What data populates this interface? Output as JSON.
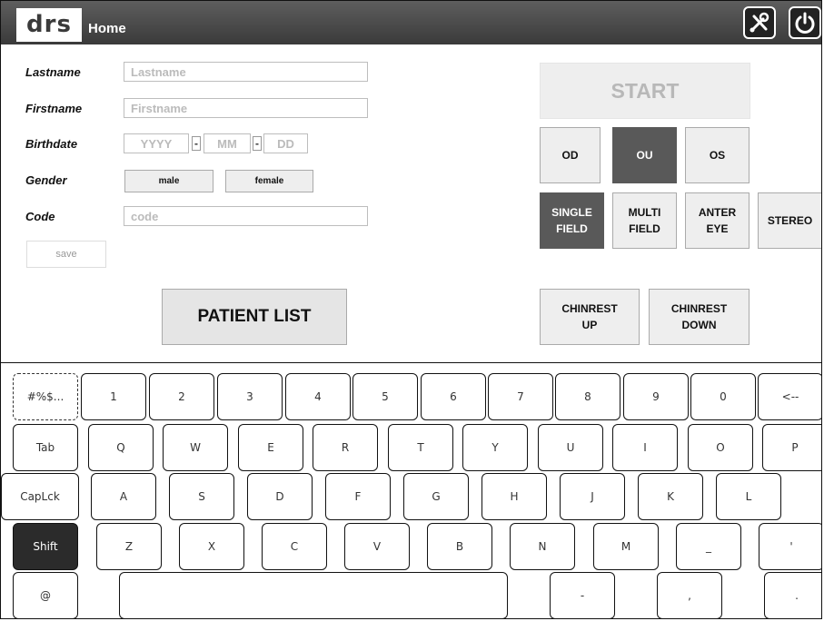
{
  "header": {
    "logo": "drs",
    "title": "Home",
    "icons": [
      "tools-icon",
      "power-icon"
    ]
  },
  "form": {
    "lastname": {
      "label": "Lastname",
      "placeholder": "Lastname"
    },
    "firstname": {
      "label": "Firstname",
      "placeholder": "Firstname"
    },
    "birthdate": {
      "label": "Birthdate",
      "year_placeholder": "YYYY",
      "month_placeholder": "MM",
      "day_placeholder": "DD",
      "separator": "-"
    },
    "gender": {
      "label": "Gender",
      "male": "male",
      "female": "female"
    },
    "code": {
      "label": "Code",
      "placeholder": "code"
    },
    "save_label": "save"
  },
  "patient_list_label": "PATIENT LIST",
  "controls": {
    "start_label": "START",
    "eye": {
      "od": "OD",
      "ou": "OU",
      "os": "OS",
      "selected": "OU"
    },
    "field": {
      "single": "SINGLE FIELD",
      "multi": "MULTI FIELD",
      "anter": "ANTER EYE",
      "stereo": "STEREO",
      "selected": "SINGLE FIELD"
    },
    "chinrest_up": "CHINREST UP",
    "chinrest_down": "CHINREST DOWN"
  },
  "keyboard": {
    "row1": [
      "#%$...",
      "1",
      "2",
      "3",
      "4",
      "5",
      "6",
      "7",
      "8",
      "9",
      "0",
      "<--"
    ],
    "row2": [
      "Tab",
      "Q",
      "W",
      "E",
      "R",
      "T",
      "Y",
      "U",
      "I",
      "O",
      "P"
    ],
    "row3": [
      "CapLck",
      "A",
      "S",
      "D",
      "F",
      "G",
      "H",
      "J",
      "K",
      "L"
    ],
    "row4": [
      "Shift",
      "Z",
      "X",
      "C",
      "V",
      "B",
      "N",
      "M",
      "_",
      "'"
    ],
    "row5": [
      "@",
      "",
      "-",
      ",",
      "."
    ]
  }
}
